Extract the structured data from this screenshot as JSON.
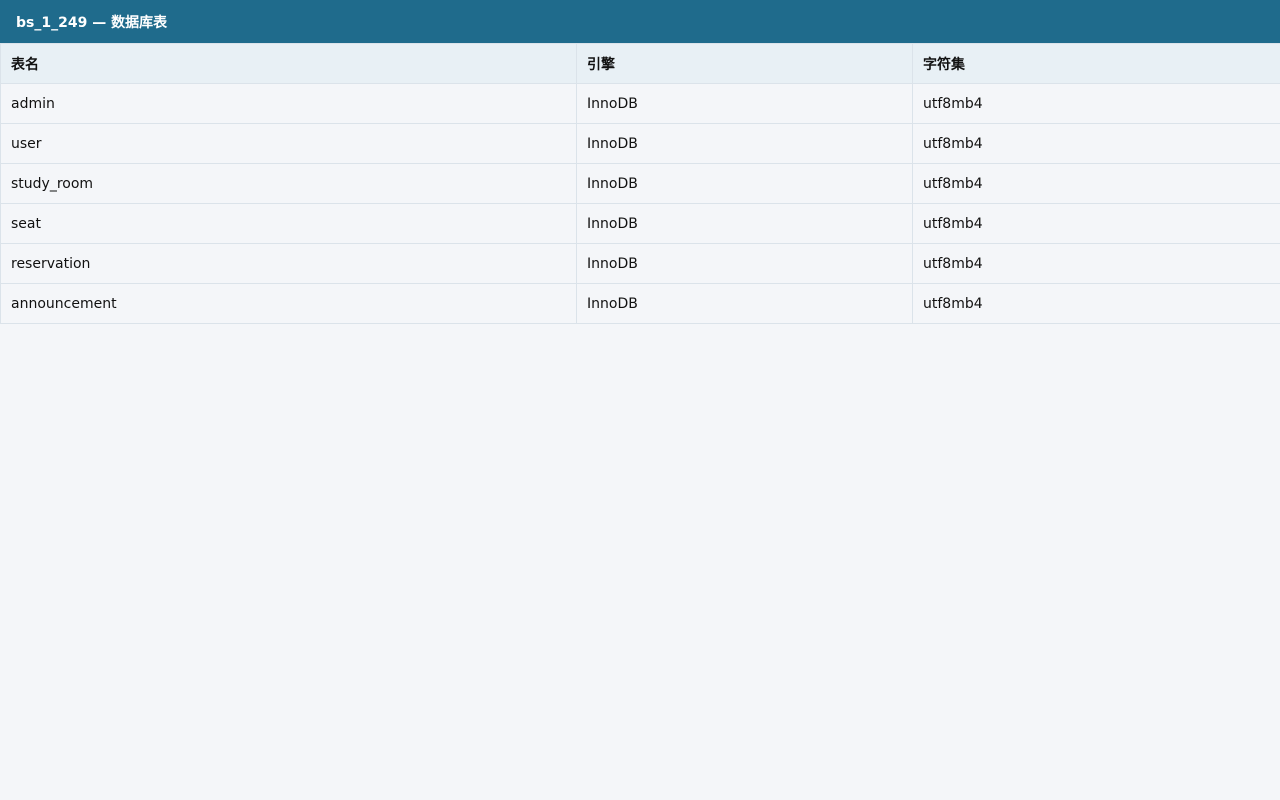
{
  "window": {
    "title": "bs_1_249 — 数据库表"
  },
  "table": {
    "headers": [
      "表名",
      "引擎",
      "字符集"
    ],
    "rows": [
      [
        "admin",
        "InnoDB",
        "utf8mb4"
      ],
      [
        "user",
        "InnoDB",
        "utf8mb4"
      ],
      [
        "study_room",
        "InnoDB",
        "utf8mb4"
      ],
      [
        "seat",
        "InnoDB",
        "utf8mb4"
      ],
      [
        "reservation",
        "InnoDB",
        "utf8mb4"
      ],
      [
        "announcement",
        "InnoDB",
        "utf8mb4"
      ]
    ]
  },
  "colors": {
    "titlebar": "#1f6b8c",
    "header_bg": "#e8f0f5",
    "page_bg": "#f4f6f9"
  }
}
